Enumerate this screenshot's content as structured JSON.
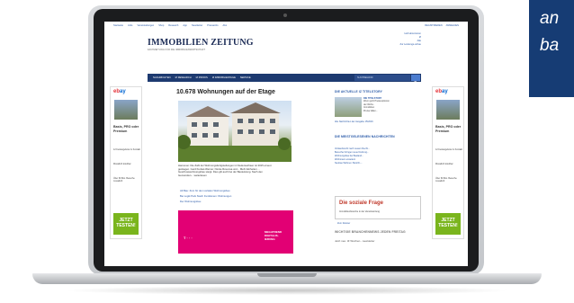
{
  "promo": {
    "line1": "an",
    "line2": "ba"
  },
  "site": {
    "topnav": [
      "Startseite",
      "Jobs",
      "Veranstaltungen",
      "Shop",
      "Research",
      "App",
      "Newsletter",
      "Presseinfo",
      "Abo"
    ],
    "topright": [
      "REGISTRIEREN",
      "ANMELDEN"
    ],
    "logo": "IMMOBILIEN ZEITUNG",
    "tagline": "FACHZEITUNG FÜR DIE IMMOBILIENWIRTSCHAFT",
    "header_right": [
      "Heft abonnieren",
      "IZ",
      "Alle",
      "Zur Leistungs-schau"
    ],
    "nav": [
      "NACHRICHTEN",
      "IZ RESEARCH",
      "IZ PROFIS",
      "IZ IMMOBILIENTAGE",
      "SERVICE"
    ],
    "search_placeholder": "SUCHBEGRIFF",
    "ad": {
      "brand_1": "eb",
      "brand_2": "ay",
      "title": "Basis, PRO oder Premium",
      "bullets": [
        "12 Festangebote im Kontakt",
        "Monatlich kündbar",
        "Über 60 Mio. Besuche monatlich"
      ],
      "cta_1": "JETZT",
      "cta_2": "TESTEN!"
    },
    "headline": "10.678 Wohnungen auf der Etage",
    "body": [
      "Hannover. Die Zahl der Wohnungsfertigstellungen in Niedersachsen ist 2015 erneut",
      "gestiegen. Gerd Kunkel-Werner, Nicole Rovensa und... Mehr Einheiten ...",
      "Geschosswohnungsbau steigt. Dies gilt auch bei der Bauleistung. Nach den",
      "Gemeinden... weiterlesen"
    ],
    "links": [
      "Alt Bau: Zum für den sozialen Wohnungsbau",
      "Bei Logik Park Stadt: Funktionen: Wohnungen",
      "Der Wohnungsbau"
    ],
    "magenta_left": "T · · ·",
    "magenta_right": [
      "MEGATREND",
      "DIGITALIS-",
      "IERUNG"
    ],
    "right_head_1": "DIE AKTUELLE IZ TITELSTORY",
    "right_text": [
      "DIE TITELSTORY",
      "Wenn jetzt Preisexplosion",
      "der Wohn-",
      "Immobilien",
      "Preise fallen..."
    ],
    "right_link_1": "Alle Nachrichten der Ausgabe 15/2016",
    "right_head_2": "DIE MEISTGELESENEN NACHRICHTEN",
    "most_read": [
      "Vorkaufsrecht nach neuem Recht...",
      "Besucher bringen neue Nutzung...",
      "Wohnungsbau bei Bauland...",
      "Wohnraum erweitern",
      "Neubau Wohnen: Bericht-..."
    ],
    "soziale_head": "Die soziale Frage",
    "soziale_sub": "Immobilienbranche in der Verantwortung",
    "soziale_link": "Zum Dossier",
    "right_head_3": "WICHTIGE BRANCHENNEWS JEDEN FREITAG",
    "right_text_3": "Jetzt neu: IZ Wochen...newsletter"
  }
}
